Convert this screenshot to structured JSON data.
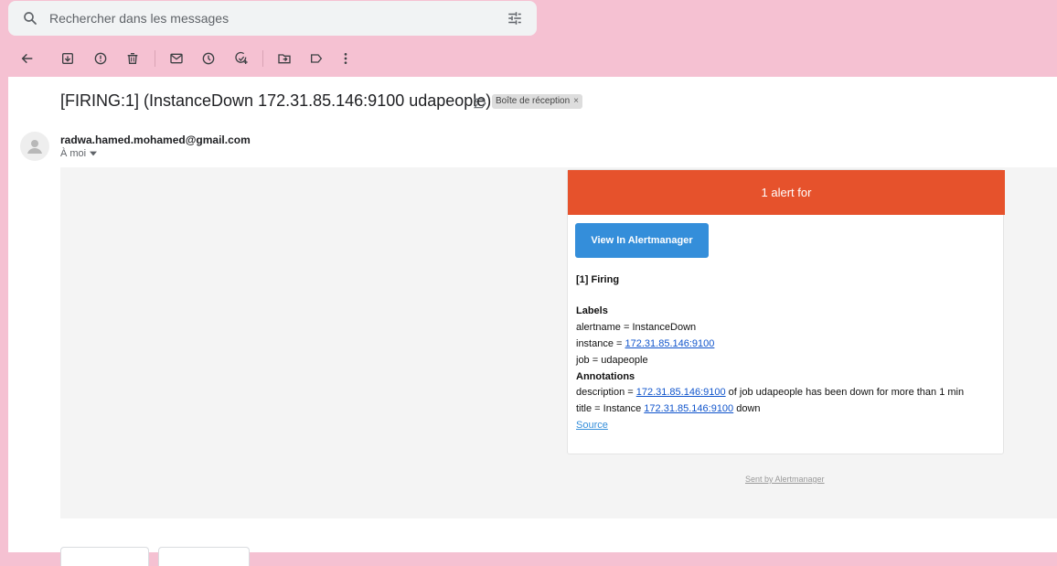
{
  "search": {
    "placeholder": "Rechercher dans les messages"
  },
  "toolbar": {
    "icons": [
      "back-arrow-icon",
      "archive-icon",
      "report-spam-icon",
      "delete-icon",
      "mark-unread-icon",
      "snooze-icon",
      "add-task-icon",
      "move-to-icon",
      "label-icon",
      "more-icon"
    ]
  },
  "email": {
    "subject": "[FIRING:1] (InstanceDown 172.31.85.146:9100 udapeople)",
    "label": "Boîte de réception",
    "label_close": "×",
    "sender": "radwa.hamed.mohamed@gmail.com",
    "to": "À moi"
  },
  "alert": {
    "header": "1 alert for",
    "button": "View In Alertmanager",
    "firing": "[1] Firing",
    "labels_heading": "Labels",
    "alertname": "alertname = InstanceDown",
    "instance_prefix": "instance = ",
    "instance_link": "172.31.85.146:9100",
    "job": "job = udapeople",
    "annotations_heading": "Annotations",
    "description_prefix": "description = ",
    "description_link": "172.31.85.146:9100",
    "description_suffix": " of job udapeople has been down for more than 1 min",
    "title_prefix": "title = Instance ",
    "title_link": "172.31.85.146:9100",
    "title_suffix": " down",
    "source": "Source",
    "footer": "Sent by Alertmanager"
  },
  "colors": {
    "background": "#f5c1d2",
    "alert_header": "#e6522c",
    "button": "#348eda"
  }
}
